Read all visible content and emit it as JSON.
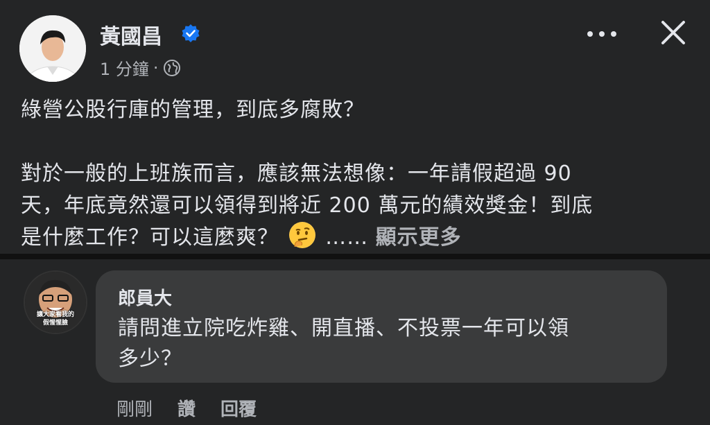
{
  "post": {
    "author": "黃國昌",
    "time": "1 分鐘",
    "meta_sep": "·",
    "lines": [
      "綠營公股行庫的管理，到底多腐敗？",
      "",
      "對於一般的上班族而言，應該無法想像：一年請假超過 90",
      "天，年底竟然還可以領得到將近 200 萬元的績效獎金！到底"
    ],
    "last_line": "是什麼工作？可以這麼爽？",
    "ellipsis": "……",
    "see_more": "顯示更多",
    "icons": {
      "verified": "verified-badge-icon",
      "privacy": "globe-icon",
      "more": "more-options-icon",
      "close": "close-icon",
      "emoji": "thinking-face-emoji"
    }
  },
  "comment": {
    "author": "郎員大",
    "text_line1": "請問進立院吃炸雞、開直播、不投票一年可以領",
    "text_line2": "多少？",
    "avatar_caption_line1": "讓大家看我的",
    "avatar_caption_line2": "假惺惺臉",
    "actions": {
      "time": "剛剛",
      "like": "讚",
      "reply": "回覆"
    }
  },
  "colors": {
    "background": "#242526",
    "bubble": "#3a3b3c",
    "primary_text": "#e4e6eb",
    "secondary_text": "#b0b3b8",
    "verified_blue": "#1877f2"
  }
}
